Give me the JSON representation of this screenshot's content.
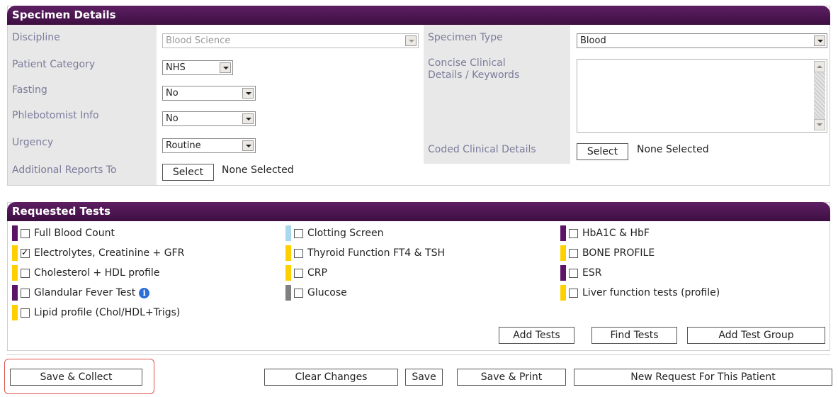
{
  "specimen": {
    "title": "Specimen Details",
    "discipline_label": "Discipline",
    "discipline_value": "Blood Science",
    "patient_category_label": "Patient Category",
    "patient_category_value": "NHS",
    "fasting_label": "Fasting",
    "fasting_value": "No",
    "phlebotomist_label": "Phlebotomist Info",
    "phlebotomist_value": "No",
    "urgency_label": "Urgency",
    "urgency_value": "Routine",
    "additional_reports_label": "Additional Reports To",
    "additional_reports_button": "Select",
    "additional_reports_value": "None Selected",
    "specimen_type_label": "Specimen Type",
    "specimen_type_value": "Blood",
    "clinical_details_label_line1": "Concise Clinical",
    "clinical_details_label_line2": "Details / Keywords",
    "clinical_details_value": "",
    "coded_details_label": "Coded Clinical Details",
    "coded_details_button": "Select",
    "coded_details_value": "None Selected"
  },
  "tests": {
    "title": "Requested Tests",
    "col1": [
      {
        "label": "Full Blood Count",
        "color": "#5c1566",
        "checked": false
      },
      {
        "label": "Electrolytes, Creatinine + GFR",
        "color": "#ffd000",
        "checked": true
      },
      {
        "label": "Cholesterol + HDL profile",
        "color": "#ffd000",
        "checked": false
      },
      {
        "label": "Glandular Fever Test",
        "color": "#5c1566",
        "checked": false
      },
      {
        "label": "Lipid profile (Chol/HDL+Trigs)",
        "color": "#ffd000",
        "checked": false
      }
    ],
    "col2": [
      {
        "label": "Clotting Screen",
        "color": "#a9d8ec",
        "checked": false
      },
      {
        "label": "Thyroid Function FT4 & TSH",
        "color": "#ffd000",
        "checked": false
      },
      {
        "label": "CRP",
        "color": "#ffd000",
        "checked": false
      },
      {
        "label": "Glucose",
        "color": "#808080",
        "checked": false
      }
    ],
    "col3": [
      {
        "label": "HbA1C & HbF",
        "color": "#5c1566",
        "checked": false
      },
      {
        "label": "BONE PROFILE",
        "color": "#ffd000",
        "checked": false
      },
      {
        "label": "ESR",
        "color": "#5c1566",
        "checked": false
      },
      {
        "label": "Liver function tests (profile)",
        "color": "#ffd000",
        "checked": false
      }
    ],
    "info_icon": "i",
    "add_tests": "Add Tests",
    "find_tests": "Find Tests",
    "add_test_group": "Add Test Group"
  },
  "actions": {
    "save_collect": "Save & Collect",
    "clear_changes": "Clear Changes",
    "save": "Save",
    "save_print": "Save & Print",
    "new_request": "New Request For This Patient"
  }
}
